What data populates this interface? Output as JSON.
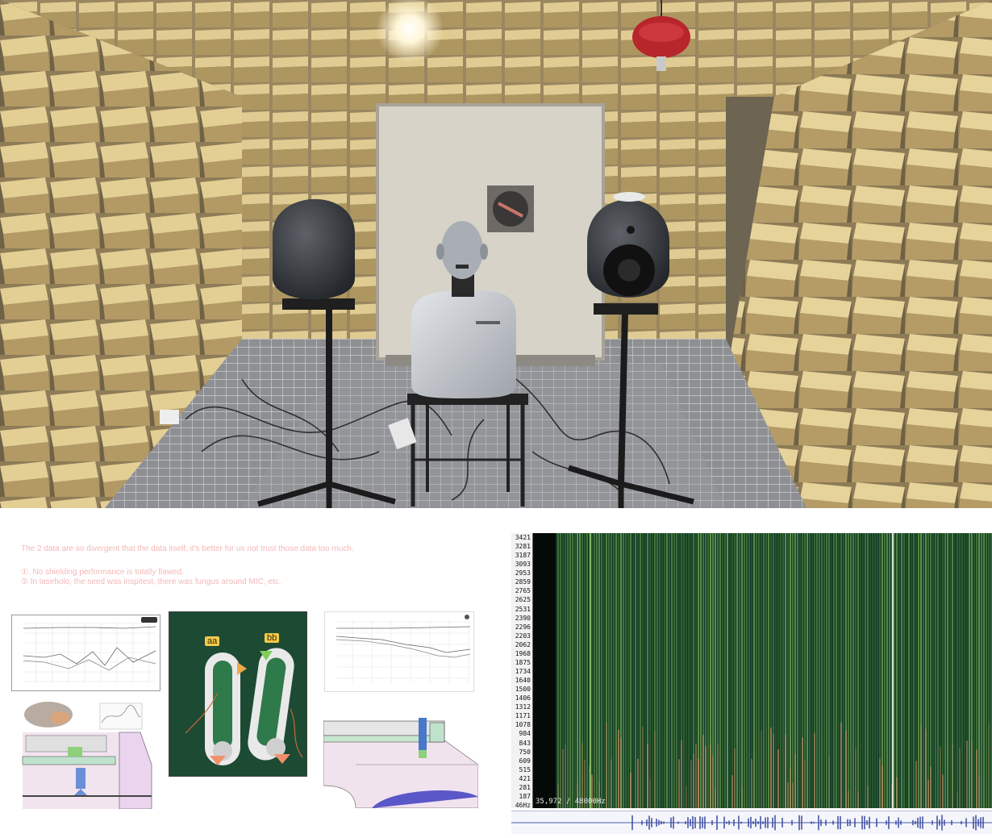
{
  "notes": {
    "line1": "The 2 data are so divergent that the data itself, it's better for us not trust those data too much.",
    "line2": "①. No shielding performance is totally flawed.",
    "line3": "② In laseholo, the seed was inspitest, there was fungus around MIC, etc."
  },
  "assembly_photo": {
    "label_left": "aa",
    "label_right": "bb"
  },
  "spectrogram": {
    "freq_ticks": [
      "3421",
      "3281",
      "3187",
      "3093",
      "2953",
      "2859",
      "2765",
      "2625",
      "2531",
      "2390",
      "2296",
      "2203",
      "2062",
      "1968",
      "1875",
      "1734",
      "1640",
      "1500",
      "1406",
      "1312",
      "1171",
      "1078",
      "984",
      "843",
      "750",
      "609",
      "515",
      "421",
      "281",
      "187",
      "46Hz"
    ],
    "readout": "35,972 / 48000Hz",
    "colors": {
      "background": "#0f3a24",
      "band": "#7fb25a",
      "hot": "#d98a6a"
    }
  },
  "icons": [
    "loudspeaker",
    "head-and-torso-simulator",
    "microphone-stand",
    "acoustic-wedge"
  ]
}
